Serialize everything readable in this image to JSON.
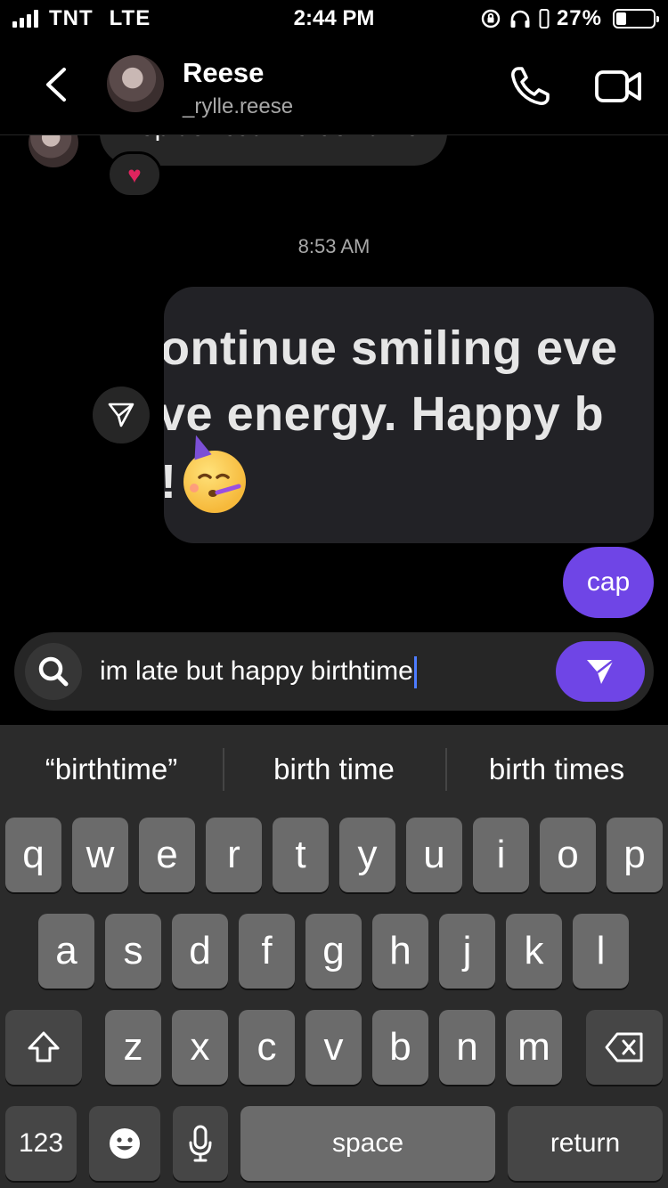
{
  "status_bar": {
    "carrier": "TNT",
    "network": "LTE",
    "time": "2:44 PM",
    "battery_percent": "27%",
    "battery_level": 0.27
  },
  "header": {
    "name": "Reese",
    "username": "_rylle.reese"
  },
  "messages": {
    "incoming_text": "Top tier but..? u don't me?",
    "reaction": "♥",
    "timestamp": "8:53 AM",
    "image_text": {
      "line1": "ontinue smiling eve",
      "line2": "ve energy. Happy b",
      "line3": "!"
    },
    "outgoing_text": "cap"
  },
  "composer": {
    "value": "im late but happy birthtime"
  },
  "keyboard": {
    "suggestions": [
      "“birthtime”",
      "birth time",
      "birth times"
    ],
    "row1": [
      "q",
      "w",
      "e",
      "r",
      "t",
      "y",
      "u",
      "i",
      "o",
      "p"
    ],
    "row2": [
      "a",
      "s",
      "d",
      "f",
      "g",
      "h",
      "j",
      "k",
      "l"
    ],
    "row3": [
      "z",
      "x",
      "c",
      "v",
      "b",
      "n",
      "m"
    ],
    "numbers_label": "123",
    "space_label": "space",
    "return_label": "return"
  }
}
